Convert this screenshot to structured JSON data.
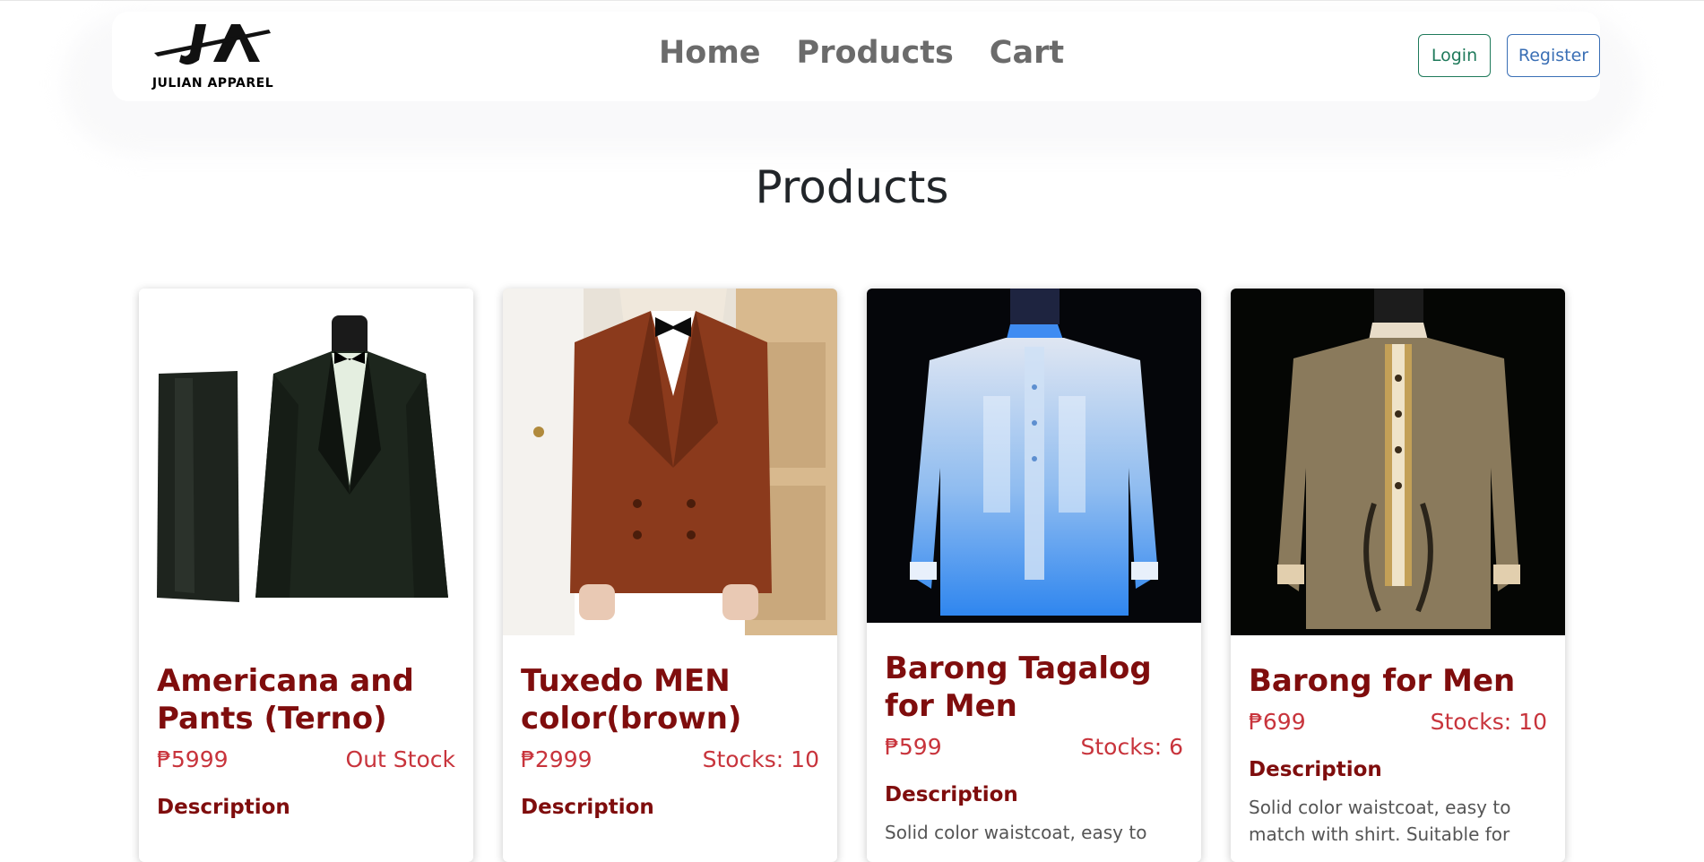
{
  "brand": {
    "logo_text": "JULIAN APPAREL"
  },
  "nav": {
    "links": [
      "Home",
      "Products",
      "Cart"
    ],
    "login_label": "Login",
    "register_label": "Register"
  },
  "page_title": "Products",
  "products": [
    {
      "title": "Americana and Pants (Terno)",
      "price": "₱5999",
      "stock": "Out Stock",
      "description_heading": "Description",
      "description": ""
    },
    {
      "title": "Tuxedo MEN color(brown)",
      "price": "₱2999",
      "stock": "Stocks: 10",
      "description_heading": "Description",
      "description": ""
    },
    {
      "title": "Barong Tagalog for Men",
      "price": "₱599",
      "stock": "Stocks: 6",
      "description_heading": "Description",
      "description": "Solid color waistcoat, easy to"
    },
    {
      "title": "Barong for Men",
      "price": "₱699",
      "stock": "Stocks: 10",
      "description_heading": "Description",
      "description": "Solid color waistcoat, easy to match with shirt. Suitable for"
    }
  ],
  "colors": {
    "title": "#7f0d0d",
    "price": "#c8343c",
    "nav_link": "#6b6b6b",
    "login": "#1f7a5b",
    "register": "#3a6fb5"
  }
}
